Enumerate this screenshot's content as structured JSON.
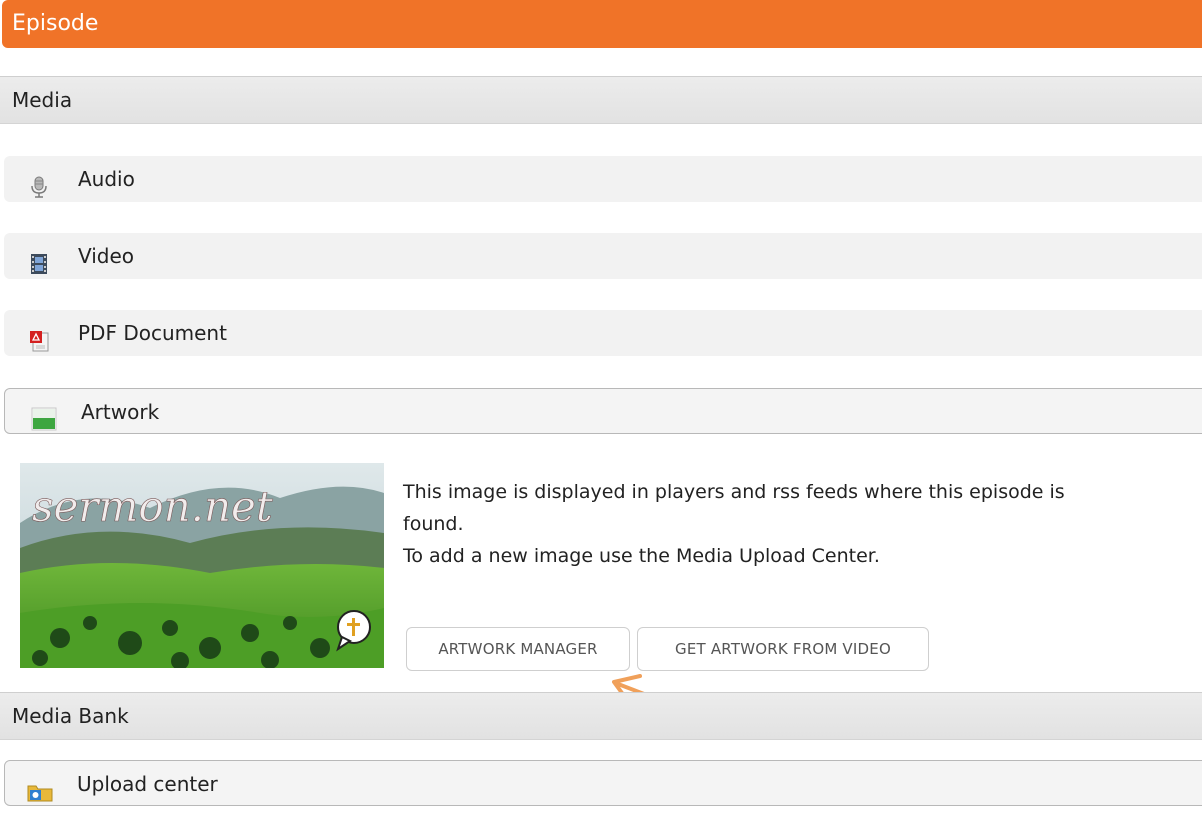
{
  "header": {
    "title": "Episode"
  },
  "media_section": {
    "title": "Media"
  },
  "media_items": [
    {
      "label": "Audio",
      "icon": "microphone-icon"
    },
    {
      "label": "Video",
      "icon": "film-icon"
    },
    {
      "label": "PDF Document",
      "icon": "pdf-icon"
    },
    {
      "label": "Artwork",
      "icon": "artwork-icon"
    }
  ],
  "artwork": {
    "image_caption": "sermon.net",
    "description_line1": "This image is displayed in players and rss feeds where this episode is",
    "description_line2": "found.",
    "description_line3": "To add a new image use the Media Upload Center.",
    "button_manager": "ARTWORK MANAGER",
    "button_from_video": "GET ARTWORK FROM VIDEO"
  },
  "media_bank": {
    "title": "Media Bank",
    "upload_label": "Upload center",
    "upload_icon": "upload-folder-icon"
  },
  "colors": {
    "accent": "#f07328",
    "arrow": "#f0a05a"
  }
}
